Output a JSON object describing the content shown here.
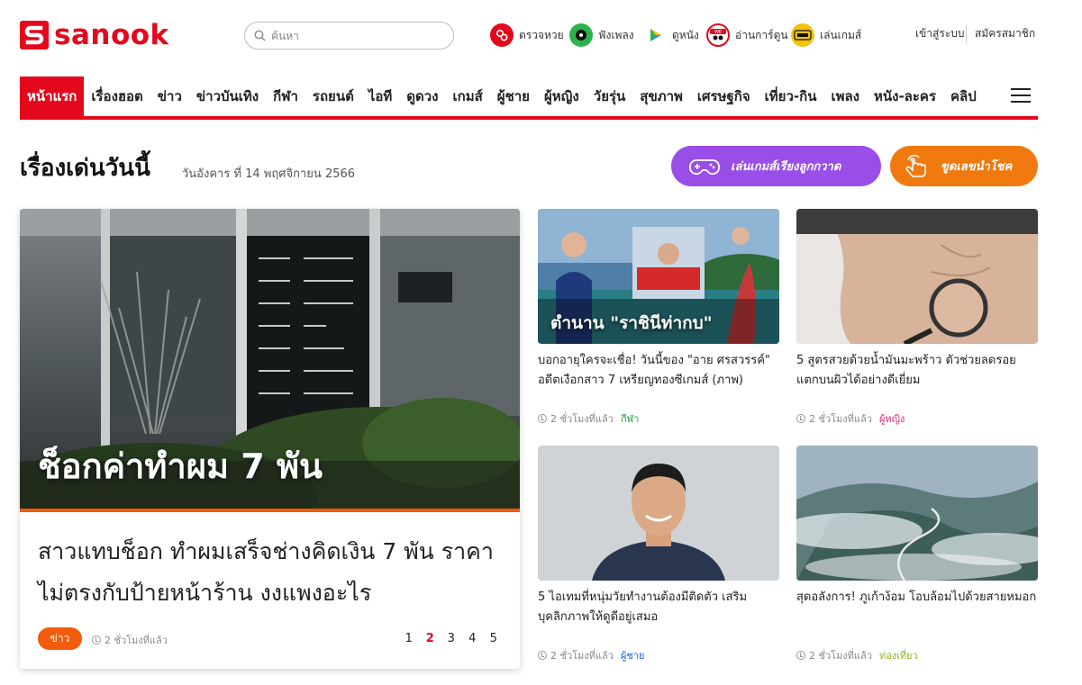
{
  "brand": {
    "name": "sanook",
    "accent": "#e4081c"
  },
  "search": {
    "placeholder": "ค้นหา"
  },
  "quick_links": [
    {
      "label": "ตรวจหวย",
      "icon": "lottery-icon",
      "color": "#e4081c"
    },
    {
      "label": "ฟังเพลง",
      "icon": "music-icon",
      "color": "#2db34a"
    },
    {
      "label": "ดูหนัง",
      "icon": "play-icon",
      "color": "#3b8bff"
    },
    {
      "label": "อ่านการ์ตูน",
      "icon": "comic-icon",
      "color": "#e4081c"
    },
    {
      "label": "เล่นเกมส์",
      "icon": "pubg-icon",
      "color": "#f2c20d"
    }
  ],
  "auth": {
    "login": "เข้าสู่ระบบ",
    "register": "สมัครสมาชิก"
  },
  "nav": {
    "items": [
      "หน้าแรก",
      "เรื่องฮอต",
      "ข่าว",
      "ข่าวบันเทิง",
      "กีฬา",
      "รถยนต์",
      "ไอที",
      "ดูดวง",
      "เกมส์",
      "ผู้ชาย",
      "ผู้หญิง",
      "วัยรุ่น",
      "สุขภาพ",
      "เศรษฐกิจ",
      "เที่ยว-กิน",
      "เพลง",
      "หนัง-ละคร",
      "คลิป"
    ],
    "active_index": 0
  },
  "section": {
    "title": "เรื่องเด่นวันนี้",
    "date": "วันอังคาร ที่ 14 พฤศจิกายน 2566",
    "game_button": "เล่นเกมส์เรียงลูกกวาด",
    "luck_button": "ขูดเลขนำโชค",
    "game_color": "#9a4ee8",
    "luck_color": "#f07a10"
  },
  "hero": {
    "image_caption": "ช็อกค่าทำผม 7 พัน",
    "headline": "สาวแทบช็อก ทำผมเสร็จช่างคิดเงิน 7 พัน ราคาไม่ตรงกับป้ายหน้าร้าน งงแพงอะไร",
    "category": "ข่าว",
    "time": "2 ชั่วโมงที่แล้ว",
    "pages": [
      "1",
      "2",
      "3",
      "4",
      "5"
    ],
    "current_page": "2"
  },
  "cards": [
    {
      "image_caption": "ตำนาน \"ราชินีท่ากบ\"",
      "title": "บอกอายุใครจะเชื่อ! วันนี้ของ \"อาย ศรสวรรค์\" อดีตเงือกสาว 7 เหรียญทองซีเกมส์ (ภาพ)",
      "time": "2 ชั่วโมงที่แล้ว",
      "category": "กีฬา",
      "category_color": "#1a9e3a"
    },
    {
      "image_caption": "",
      "title": "5 สูตรสวยด้วยน้ำมันมะพร้าว ตัวช่วยลดรอยแตกบนผิวได้อย่างดีเยี่ยม",
      "time": "2 ชั่วโมงที่แล้ว",
      "category": "ผู้หญิง",
      "category_color": "#e0257a"
    },
    {
      "image_caption": "",
      "title": "5 ไอเทมที่หนุ่มวัยทำงานต้องมีติดตัว เสริมบุคลิกภาพให้ดูดีอยู่เสมอ",
      "time": "2 ชั่วโมงที่แล้ว",
      "category": "ผู้ชาย",
      "category_color": "#1f5fd6"
    },
    {
      "image_caption": "",
      "title": "สุดอลังการ! ภูเก้าง้อม โอบล้อมไปด้วยสายหมอก",
      "time": "2 ชั่วโมงที่แล้ว",
      "category": "ท่องเที่ยว",
      "category_color": "#8cb51c"
    }
  ]
}
